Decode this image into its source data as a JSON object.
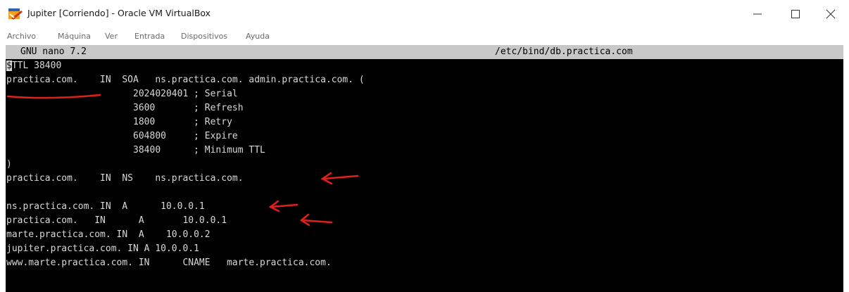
{
  "window": {
    "title": "Jupiter [Corriendo] - Oracle VM VirtualBox",
    "icon": "virtualbox-icon"
  },
  "menu": {
    "items": [
      "Archivo",
      "Máquina",
      "Ver",
      "Entrada",
      "Dispositivos",
      "Ayuda"
    ]
  },
  "nano": {
    "version": "GNU nano 7.2",
    "filename": "/etc/bind/db.practica.com"
  },
  "file": {
    "lines": [
      {
        "cursor": "$",
        "text": "TTL 38400"
      },
      {
        "text": "practica.com.    IN  SOA   ns.practica.com. admin.practica.com. ("
      },
      {
        "text": "                       2024020401 ; Serial"
      },
      {
        "text": "                       3600       ; Refresh"
      },
      {
        "text": "                       1800       ; Retry"
      },
      {
        "text": "                       604800     ; Expire"
      },
      {
        "text": "                       38400      ; Minimum TTL"
      },
      {
        "text": ")"
      },
      {
        "text": "practica.com.    IN  NS    ns.practica.com."
      },
      {
        "text": ""
      },
      {
        "text": "ns.practica.com. IN  A      10.0.0.1"
      },
      {
        "text": "practica.com.   IN      A       10.0.0.1"
      },
      {
        "text": "marte.practica.com. IN  A    10.0.0.2"
      },
      {
        "text": "jupiter.practica.com. IN A 10.0.0.1"
      },
      {
        "text": "www.marte.practica.com. IN      CNAME   marte.practica.com."
      }
    ]
  },
  "annotations": {
    "color": "#e0201c",
    "marks": [
      "underline",
      "arrow",
      "arrow",
      "arrow"
    ]
  },
  "colors": {
    "terminal_bg": "#000000",
    "terminal_fg": "#d8d8d8",
    "status_bar_bg": "#c8c8c8"
  }
}
